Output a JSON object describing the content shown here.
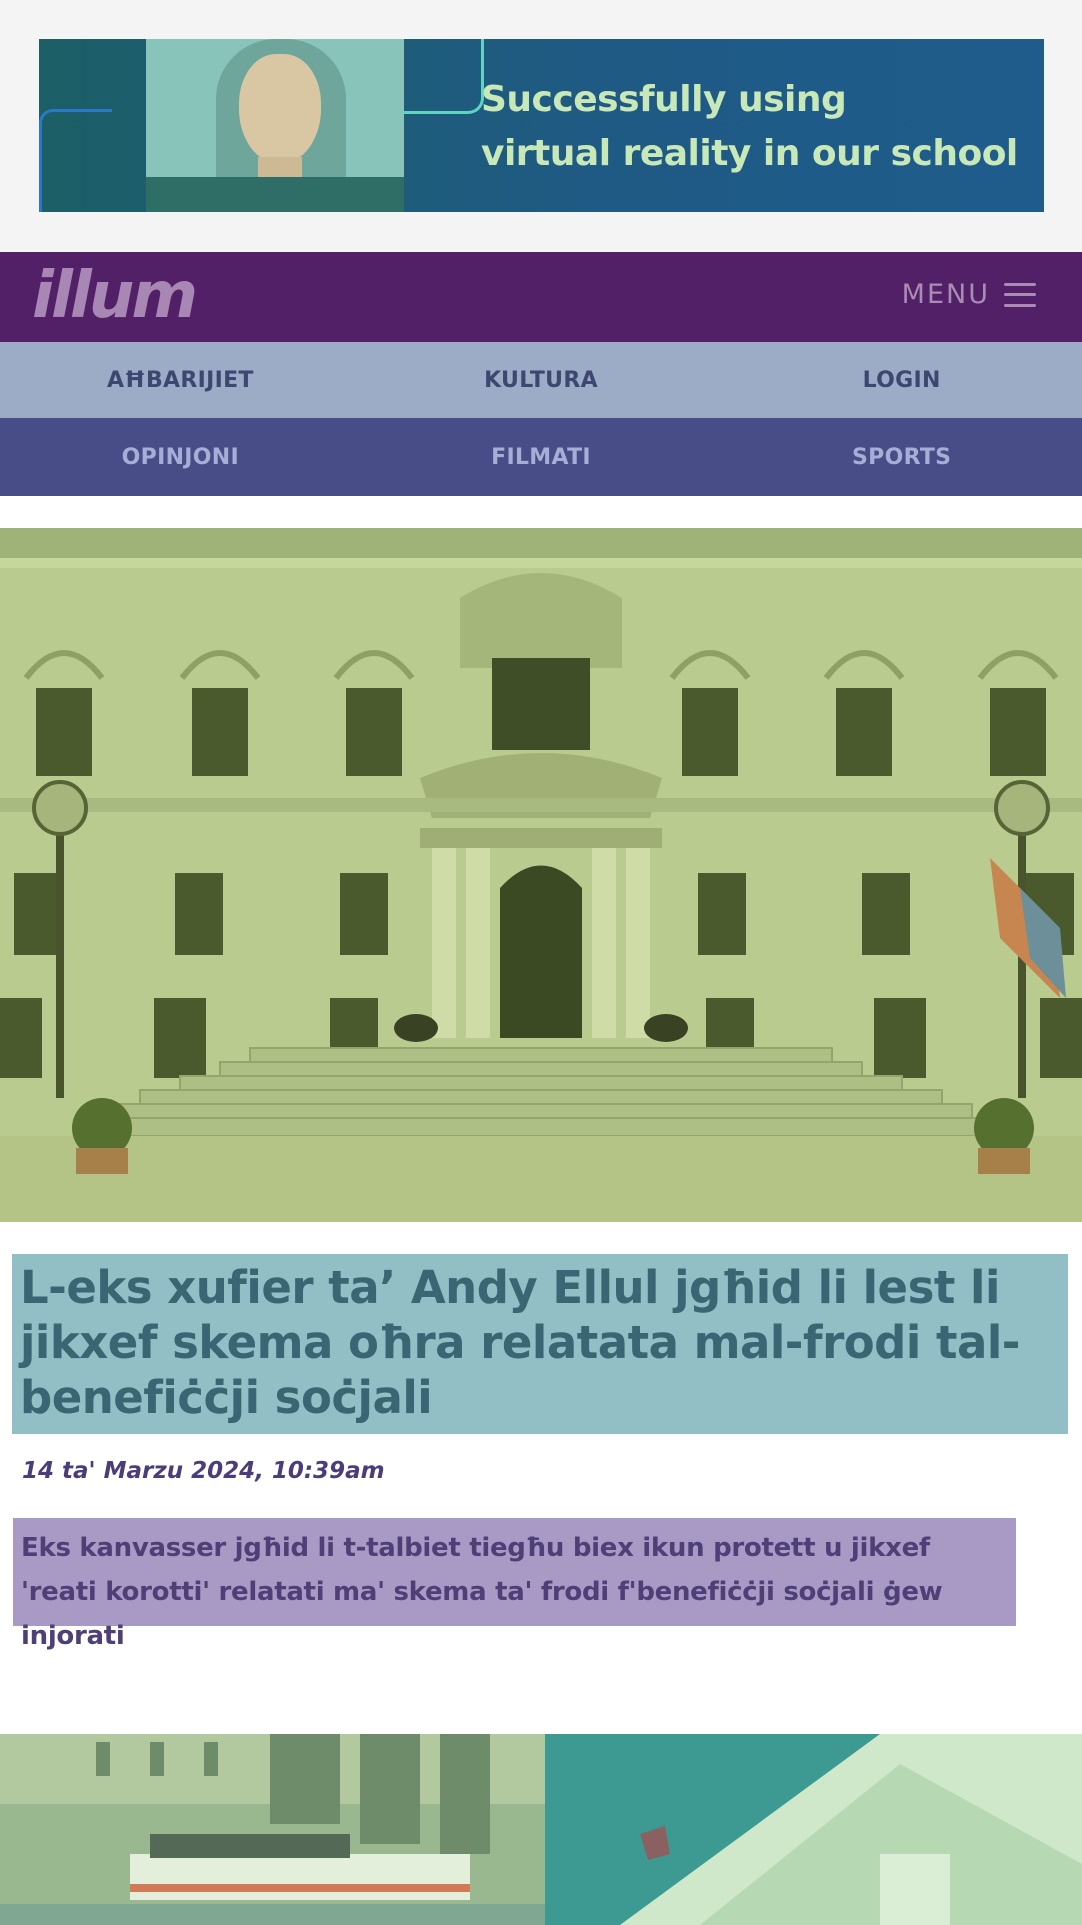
{
  "ad": {
    "headline_line1": "Successfully using",
    "headline_line2": "virtual reality in our school"
  },
  "header": {
    "logo": "illum",
    "menu_label": "MENU",
    "menu_icon": "hamburger-icon"
  },
  "nav": {
    "row1": [
      "AĦBARIJIET",
      "KULTURA",
      "LOGIN"
    ],
    "row2": [
      "OPINJONI",
      "FILMATI",
      "SPORTS"
    ]
  },
  "article": {
    "title": "L-eks xufier ta’ Andy Ellul jgħid li lest li jikxef skema oħra relatata mal-frodi tal-benefiċċji soċjali",
    "date": "14 ta' Marzu 2024, 10:39am",
    "summary": "Eks kanvasser jgħid li t-talbiet tiegħu biex ikun protett u jikxef 'reati korotti' relatati ma' skema ta' frodi f'benefiċċji soċjali ġew injorati"
  },
  "colors": {
    "header_bg": "#522066",
    "nav_row1_bg": "#9cabc6",
    "nav_row2_bg": "#484d87",
    "title_bg": "#92bec6",
    "summary_bg": "#a999c5"
  }
}
